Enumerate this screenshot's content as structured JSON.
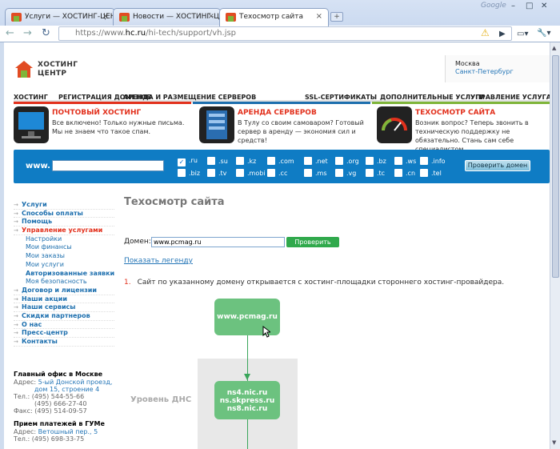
{
  "browser": {
    "tabs": [
      {
        "label": "Услуги — ХОСТИНГ-ЦЕНТР"
      },
      {
        "label": "Новости — ХОСТИНГ-ЦЕНТР"
      },
      {
        "label": "Техосмотр сайта"
      }
    ],
    "new_tab": "+",
    "google_label": "Google",
    "window_controls": [
      "–",
      "□",
      "✕"
    ],
    "url_scheme": "https://www.",
    "url_domain": "hc.ru",
    "url_path": "/hi-tech/support/vh.jsp",
    "nav": {
      "back": "←",
      "forward": "→",
      "reload": "↻",
      "star": "☆"
    },
    "actions": {
      "warning": "⚠",
      "play": "▶",
      "page": "▭▾",
      "tools": "🔧▾"
    }
  },
  "site": {
    "logo_line1": "ХОСТИНГ",
    "logo_line2": "ЦЕНТР",
    "city_current": "Москва",
    "city_other": "Санкт-Петербург",
    "top_menu": [
      "ХОСТИНГ",
      "РЕГИСТРАЦИЯ ДОМЕНОВ",
      "АРЕНДА И РАЗМЕЩЕНИЕ СЕРВЕРОВ",
      "SSL-СЕРТИФИКАТЫ",
      "ДОПОЛНИТЕЛЬНЫЕ УСЛУГИ",
      "УПРАВЛЕНИЕ УСЛУГАМИ"
    ],
    "promos": [
      {
        "title": "ПОЧТОВЫЙ ХОСТИНГ",
        "text": "Все включено! Только нужные письма. Мы не знаем что такое спам."
      },
      {
        "title": "АРЕНДА СЕРВЕРОВ",
        "text": "В Тулу со своим самоваром? Готовый сервер в аренду — экономия сил и средств!"
      },
      {
        "title": "ТЕХОСМОТР САЙТА",
        "text": "Возник вопрос? Теперь звонить в техническую поддержку не обязательно. Стань сам себе специалистом."
      }
    ],
    "domain_bar": {
      "www_label": "www.",
      "zones": [
        ".ru",
        ".su",
        ".kz",
        ".com",
        ".net",
        ".org",
        ".bz",
        ".ws",
        ".info",
        ".biz",
        ".tv",
        ".mobi",
        ".cc",
        ".ms",
        ".vg",
        ".tc",
        ".cn",
        ".tel"
      ],
      "checked_mark": "✓",
      "check_button": "Проверить домен"
    },
    "left_menu": [
      {
        "label": "Услуги",
        "type": "main"
      },
      {
        "label": "Способы оплаты",
        "type": "main"
      },
      {
        "label": "Помощь",
        "type": "main"
      },
      {
        "label": "Управление услугами",
        "type": "active"
      },
      {
        "label": "Настройки",
        "type": "sub"
      },
      {
        "label": "Мои финансы",
        "type": "sub"
      },
      {
        "label": "Мои заказы",
        "type": "sub"
      },
      {
        "label": "Мои услуги",
        "type": "sub"
      },
      {
        "label": "Авторизованные заявки",
        "type": "subbold"
      },
      {
        "label": "Моя безопасность",
        "type": "sub"
      },
      {
        "label": "Договор и лицензии",
        "type": "main"
      },
      {
        "label": "Наши акции",
        "type": "main"
      },
      {
        "label": "Наши сервисы",
        "type": "main"
      },
      {
        "label": "Скидки партнеров",
        "type": "main"
      },
      {
        "label": "О нас",
        "type": "main"
      },
      {
        "label": "Пресс-центр",
        "type": "main"
      },
      {
        "label": "Контакты",
        "type": "main"
      }
    ],
    "office": {
      "head": "Главный офис в Москве",
      "addr_label": "Адрес:",
      "addr1": "5-ый Донской проезд,",
      "addr2": "дом 15, строение 4",
      "tel_label": "Тел.:",
      "tel1": "(495) 544-55-66",
      "tel2": "(495) 666-27-40",
      "fax_label": "Факс:",
      "fax": "(495) 514-09-57",
      "pay_head": "Прием платежей в ГУМе",
      "pay_addr": "Ветошный пер., 5",
      "pay_tel": "(495) 698-33-75"
    },
    "content": {
      "title": "Техосмотр сайта",
      "domain_label": "Домен:",
      "domain_value": "www.pcmag.ru",
      "verify_button": "Проверить",
      "legend_link": "Показать легенду",
      "result_num": "1.",
      "result_text": "Сайт по указанному домену открывается с хостинг-площадки стороннего хостинг-провайдера.",
      "node_domain": "www.pcmag.ru",
      "dns_level_label": "Уровень ДНС",
      "ns": [
        "ns4.nic.ru",
        "ns.skpress.ru",
        "ns8.nic.ru"
      ]
    }
  }
}
